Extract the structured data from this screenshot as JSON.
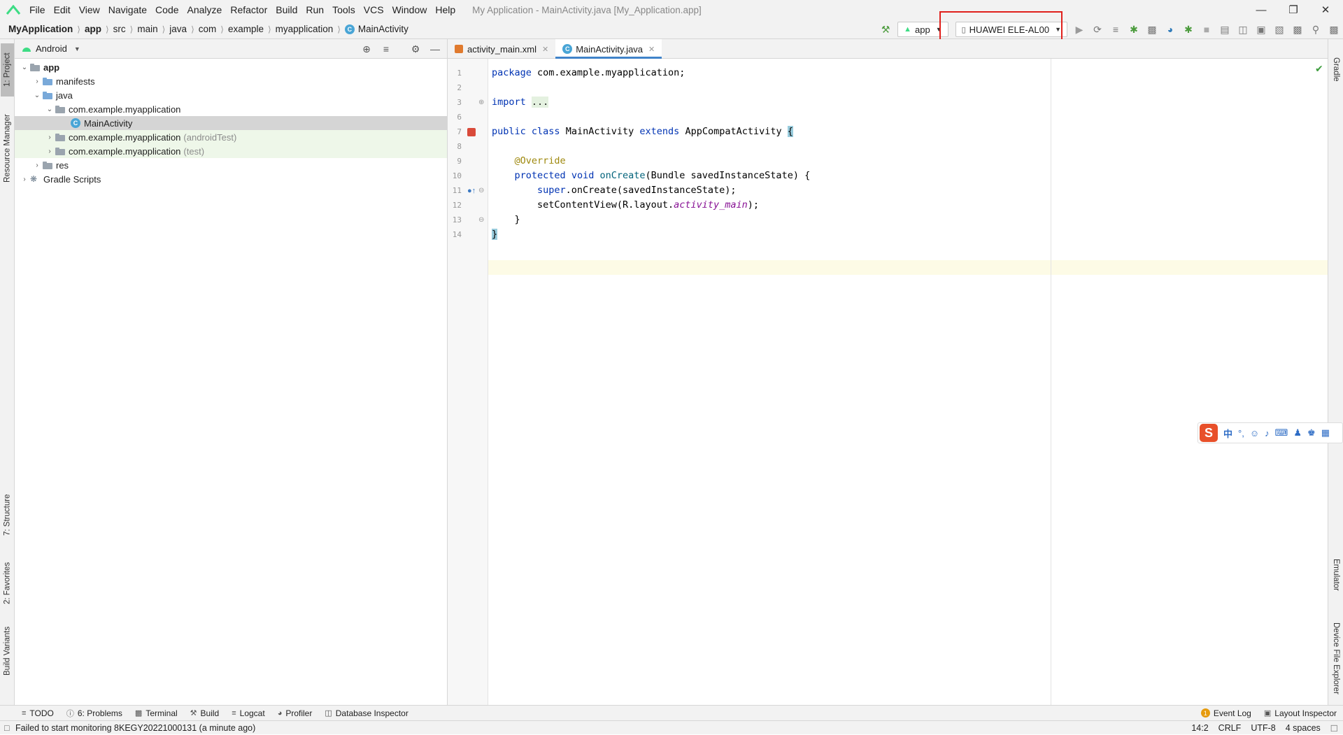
{
  "menubar": {
    "items": [
      "File",
      "Edit",
      "View",
      "Navigate",
      "Code",
      "Analyze",
      "Refactor",
      "Build",
      "Run",
      "Tools",
      "VCS",
      "Window",
      "Help"
    ],
    "window_title": "My Application - MainActivity.java [My_Application.app]"
  },
  "breadcrumb": [
    "MyApplication",
    "app",
    "src",
    "main",
    "java",
    "com",
    "example",
    "myapplication",
    "MainActivity"
  ],
  "toolbar": {
    "run_config": "app",
    "device": "HUAWEI ELE-AL00"
  },
  "project": {
    "view_mode": "Android",
    "tree": [
      {
        "label": "app",
        "level": 0,
        "expanded": true,
        "icon": "module"
      },
      {
        "label": "manifests",
        "level": 1,
        "expanded": false,
        "icon": "folder-blue"
      },
      {
        "label": "java",
        "level": 1,
        "expanded": true,
        "icon": "folder-blue"
      },
      {
        "label": "com.example.myapplication",
        "level": 2,
        "expanded": true,
        "icon": "package"
      },
      {
        "label": "MainActivity",
        "level": 3,
        "icon": "class",
        "selected": true
      },
      {
        "label": "com.example.myapplication",
        "suffix": "(androidTest)",
        "level": 2,
        "expanded": false,
        "icon": "package"
      },
      {
        "label": "com.example.myapplication",
        "suffix": "(test)",
        "level": 2,
        "expanded": false,
        "icon": "package"
      },
      {
        "label": "res",
        "level": 1,
        "expanded": false,
        "icon": "folder-gray"
      },
      {
        "label": "Gradle Scripts",
        "level": 0,
        "expanded": false,
        "icon": "gradle"
      }
    ]
  },
  "editor": {
    "tabs": [
      {
        "label": "activity_main.xml",
        "active": false
      },
      {
        "label": "MainActivity.java",
        "active": true
      }
    ],
    "line_numbers": [
      "1",
      "2",
      "3",
      "6",
      "7",
      "8",
      "9",
      "10",
      "11",
      "12",
      "13",
      "14"
    ],
    "code": {
      "l1_kw": "package",
      "l1_rest": " com.example.myapplication;",
      "l3_kw": "import",
      "l3_fold": "...",
      "l7_kw1": "public",
      "l7_kw2": "class",
      "l7_name": "MainActivity",
      "l7_kw3": "extends",
      "l7_super": "AppCompatActivity",
      "l7_brace": "{",
      "l9_ann": "@Override",
      "l10_kw1": "protected",
      "l10_kw2": "void",
      "l10_fn": "onCreate",
      "l10_rest": "(Bundle savedInstanceState) {",
      "l11_kw": "super",
      "l11_rest": ".onCreate(savedInstanceState);",
      "l12_pre": "setContentView(R.layout.",
      "l12_it": "activity_main",
      "l12_post": ");",
      "l13": "}",
      "l14": "}"
    }
  },
  "left_tool_windows": [
    "1: Project",
    "Resource Manager",
    "7: Structure",
    "2: Favorites",
    "Build Variants"
  ],
  "right_tool_windows": [
    "Gradle",
    "Emulator",
    "Device File Explorer"
  ],
  "bottom_tools": [
    "TODO",
    "6: Problems",
    "Terminal",
    "Build",
    "Logcat",
    "Profiler",
    "Database Inspector"
  ],
  "bottom_right_tools": [
    "Event Log",
    "Layout Inspector"
  ],
  "event_log_count": "1",
  "status": {
    "message": "Failed to start monitoring 8KEGY20221000131 (a minute ago)",
    "position": "14:2",
    "line_sep": "CRLF",
    "encoding": "UTF-8",
    "indent": "4 spaces"
  },
  "ime": {
    "logo": "S",
    "lang": "中"
  },
  "colors": {
    "accent": "#4083c9",
    "annotation_red": "#e0201c",
    "android_green": "#3ddc84"
  }
}
